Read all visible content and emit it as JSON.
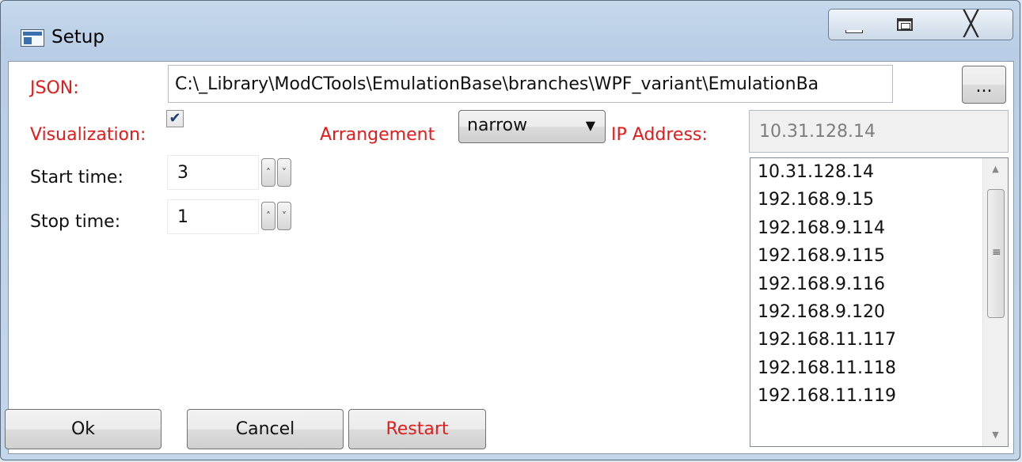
{
  "window": {
    "title": "Setup",
    "close_glyph": "╳"
  },
  "form": {
    "json_label": "JSON:",
    "json_path": "C:\\_Library\\ModCTools\\EmulationBase\\branches\\WPF_variant\\EmulationBa",
    "browse_label": "...",
    "visualization_label": "Visualization:",
    "visualization_checked": true,
    "check_glyph": "✔",
    "arrangement_label": "Arrangement",
    "arrangement_value": "narrow",
    "dropdown_glyph": "▼",
    "ip_label": "IP Address:",
    "ip_value": "10.31.128.14",
    "start_label": "Start time:",
    "start_value": "3",
    "stop_label": "Stop time:",
    "stop_value": "1",
    "spin_glyph": "˄˅"
  },
  "ip_list": {
    "items": [
      "10.31.128.14",
      "192.168.9.15",
      "192.168.9.114",
      "192.168.9.115",
      "192.168.9.116",
      "192.168.9.120",
      "192.168.11.117",
      "192.168.11.118",
      "192.168.11.119"
    ],
    "scroll_up_glyph": "▲",
    "scroll_down_glyph": "▼",
    "grip_glyph": "≡"
  },
  "buttons": {
    "ok": "Ok",
    "cancel": "Cancel",
    "restart": "Restart"
  },
  "colors": {
    "label_red": "#e31b1b",
    "chrome_blue": "#b9cee6"
  }
}
